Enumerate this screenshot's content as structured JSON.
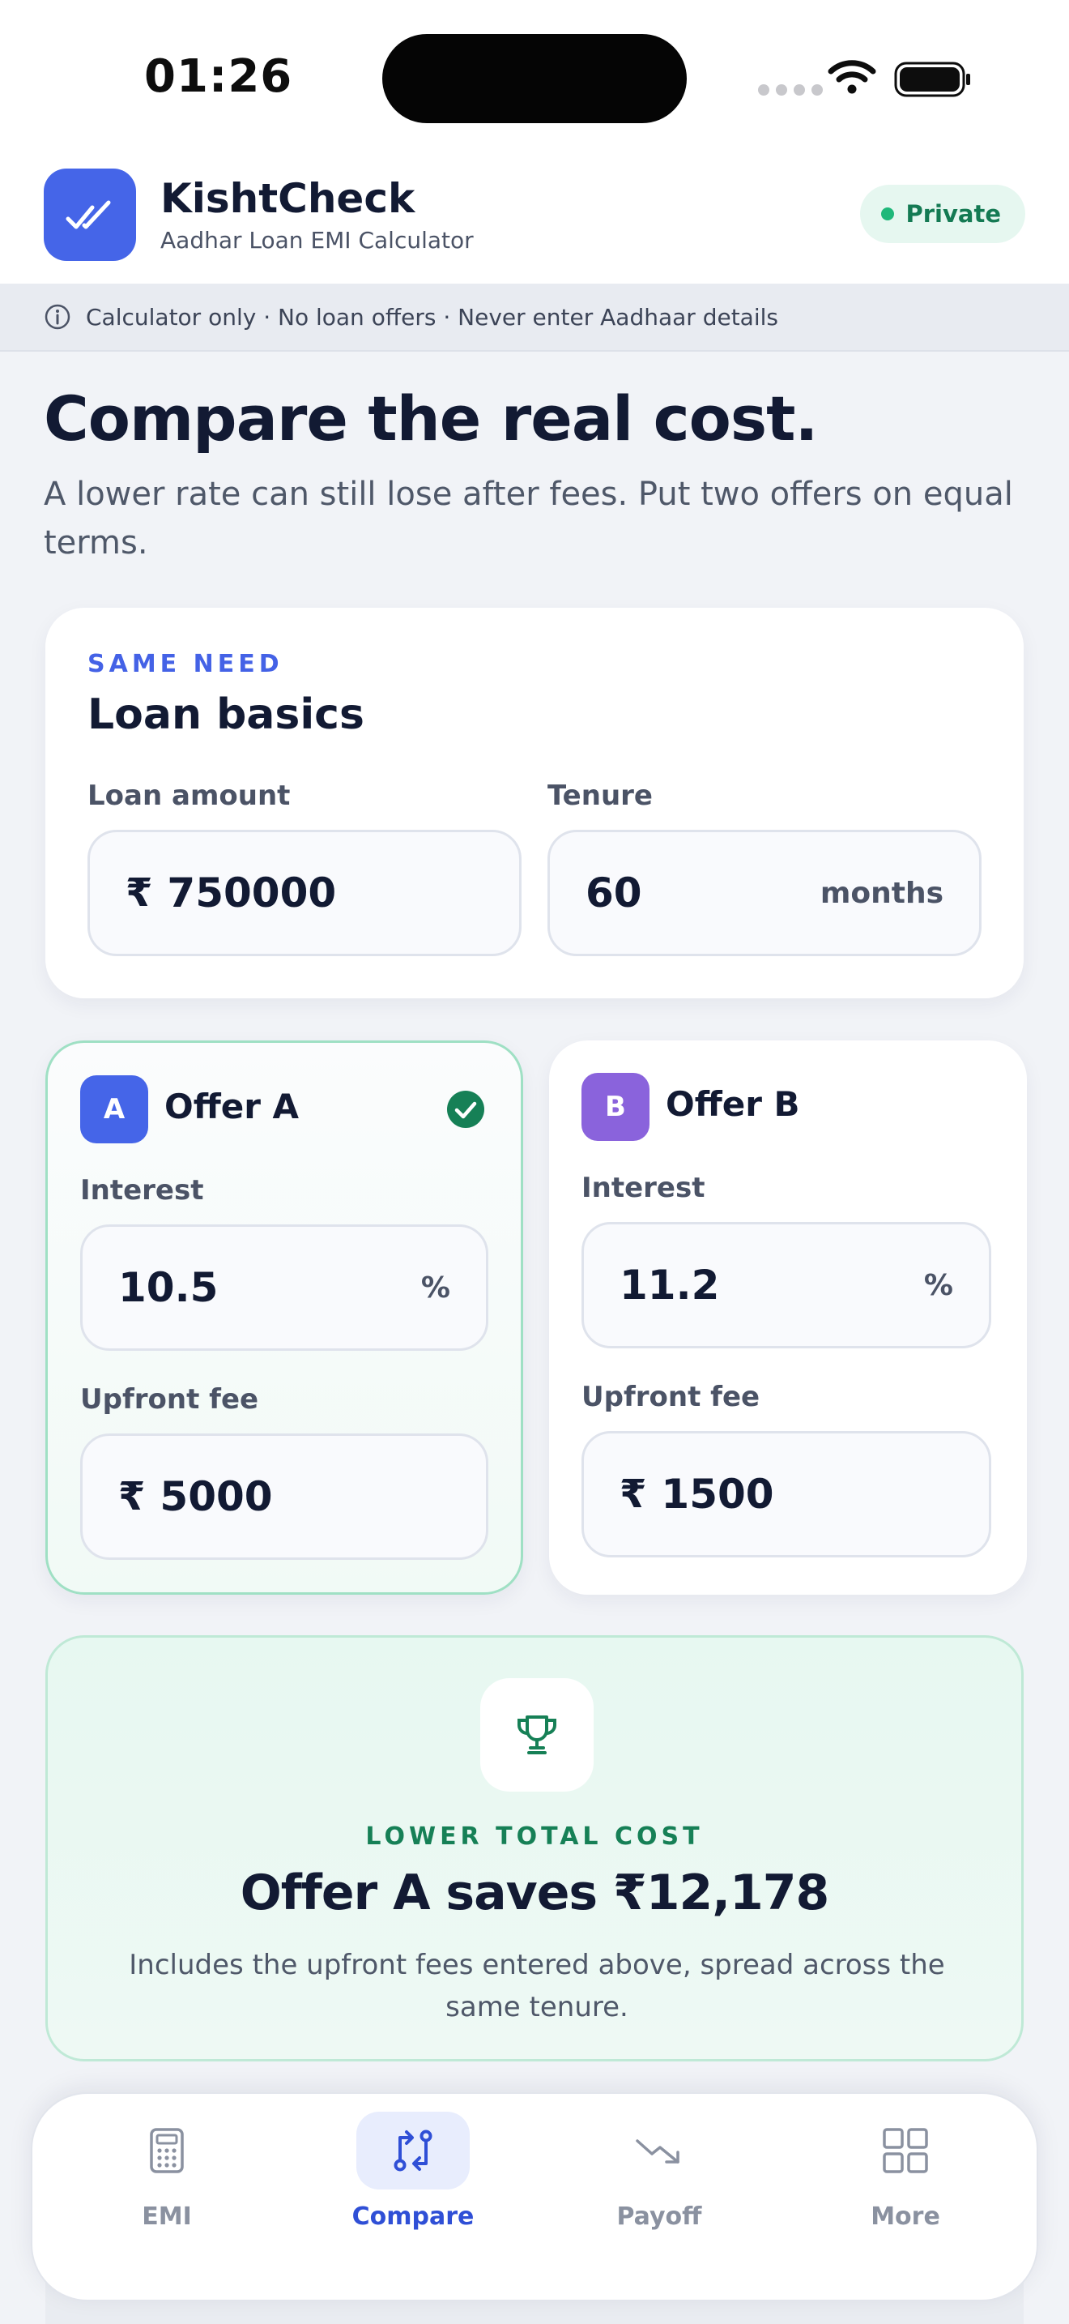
{
  "status": {
    "time": "01:26"
  },
  "header": {
    "app_name": "KishtCheck",
    "subtitle": "Aadhar Loan EMI Calculator",
    "badge": "Private"
  },
  "notice": {
    "text": "Calculator only · No loan offers · Never enter Aadhaar details"
  },
  "hero": {
    "title": "Compare the real cost.",
    "subtitle": "A lower rate can still lose after fees. Put two offers on equal terms."
  },
  "basics": {
    "eyebrow": "SAME NEED",
    "title": "Loan basics",
    "loan_amount": {
      "label": "Loan amount",
      "prefix": "₹",
      "value": "750000"
    },
    "tenure": {
      "label": "Tenure",
      "value": "60",
      "suffix": "months"
    }
  },
  "offers": [
    {
      "badge": "A",
      "title": "Offer A",
      "selected": true,
      "interest": {
        "label": "Interest",
        "value": "10.5",
        "suffix": "%"
      },
      "fee": {
        "label": "Upfront fee",
        "prefix": "₹",
        "value": "5000"
      }
    },
    {
      "badge": "B",
      "title": "Offer B",
      "selected": false,
      "interest": {
        "label": "Interest",
        "value": "11.2",
        "suffix": "%"
      },
      "fee": {
        "label": "Upfront fee",
        "prefix": "₹",
        "value": "1500"
      }
    }
  ],
  "result": {
    "icon": "trophy-icon",
    "eyebrow": "LOWER TOTAL COST",
    "title": "Offer A saves ₹12,178",
    "note": "Includes the upfront fees entered above, spread across the same tenure."
  },
  "nav": {
    "active": "Compare",
    "items": [
      {
        "label": "EMI",
        "icon": "calculator-icon"
      },
      {
        "label": "Compare",
        "icon": "compare-icon"
      },
      {
        "label": "Payoff",
        "icon": "trend-down-icon"
      },
      {
        "label": "More",
        "icon": "grid-icon"
      }
    ]
  },
  "colors": {
    "accent": "#4565e8",
    "offer_b": "#8a63dc",
    "success": "#168056",
    "success_bg": "#e7f8f1"
  }
}
